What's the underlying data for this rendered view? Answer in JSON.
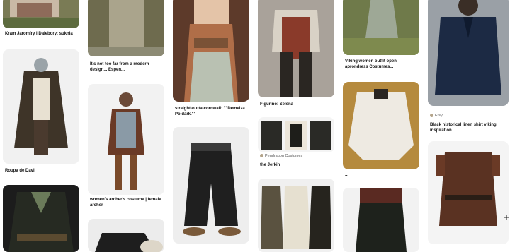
{
  "pins": [
    {
      "id": "p1",
      "caption": "Kram Jaromíry i Dalebory: suknia"
    },
    {
      "id": "p2",
      "caption": "Roupa de Davi"
    },
    {
      "id": "p4",
      "caption": "It's not too far from a modern design... Espen..."
    },
    {
      "id": "p5",
      "caption": "women's archer's costume | female archer"
    },
    {
      "id": "p7",
      "caption": "straight-outta-cornwall: \"\"Demelza Poldark.\"\""
    },
    {
      "id": "p8",
      "caption": "Figurino: Selena"
    },
    {
      "id": "p9",
      "source": "Pendragon Costumes",
      "caption": "the Jerkin"
    },
    {
      "id": "p11",
      "caption": "Viking women outfit open aprondress Costumes..."
    },
    {
      "id": "p12",
      "caption": "..."
    },
    {
      "id": "p14",
      "source": "Etsy",
      "caption": "Black historical linen shirt viking inspiration..."
    }
  ],
  "colors": {
    "background": "#ffffff",
    "caption": "#111111"
  },
  "icons": {
    "add": "+"
  }
}
